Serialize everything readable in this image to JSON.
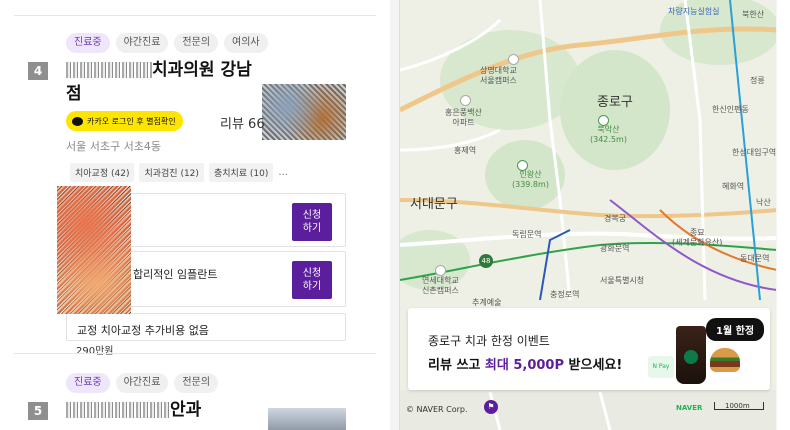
{
  "list": {
    "item4": {
      "rank": "4",
      "tags": [
        "진료중",
        "야간진료",
        "전문의",
        "여의사"
      ],
      "name_visible_1": "치과의원 강남",
      "name_visible_2": "점",
      "kakao_label": "카카오 로그인 후 별점확인",
      "review": "리뷰 66",
      "address": "서울 서초구 서초4동",
      "categories": [
        "치아교정 (42)",
        "치과검진 (12)",
        "충치치료 (10)"
      ],
      "categories_more": "...",
      "card2_text": "합리적인 임플란트",
      "card3_text": "교정 치아교정 추가비용 없음",
      "card3_price": "290만원",
      "apply_label_1": "신청",
      "apply_label_2": "하기"
    },
    "item5": {
      "rank": "5",
      "tags": [
        "진료중",
        "야간진료",
        "전문의"
      ],
      "name_visible": "안과"
    }
  },
  "map": {
    "labels": {
      "district_jongno": "종로구",
      "district_seodaemun": "서대문구",
      "sangmyung": "상명대학교\n서울캠퍼스",
      "hongeun": "홍은풍백산\n아파트",
      "bukaksan": "북악산\n(342.5m)",
      "inwangsan": "인왕산\n(339.8m)",
      "gyeongbokgung": "경복궁",
      "jongmyo": "종묘\n(세계문화유산)",
      "yonsei": "연세대학교\n신촌캠퍼스",
      "seoul_city_hall": "서울특별시청",
      "sungnyemun": "숭례문",
      "hansin": "한신인펜동",
      "hanseong": "한성대입구역",
      "charye": "차량지능실험실",
      "bukhan": "북한산",
      "jeongneung": "정릉",
      "hongje": "홍제역",
      "dongnimmun": "독립문역",
      "gwanghwamun": "광화문역",
      "jonggak": "종각역",
      "jongno3": "종로3가역",
      "euljiro": "을지로입구역",
      "seodaemun_stn": "서대문역",
      "chungjeongno": "충정로역",
      "ahyeon": "아현역",
      "chugye": "추계예술",
      "sinchon": "신촌역",
      "hyehwa": "혜화역",
      "naksan": "낙산",
      "dongdaemun": "동대문역",
      "sookdae": "숙대입구역",
      "seoul_stn": "서울역",
      "dongdaemun_gu": "동대문구",
      "road_48": "48"
    },
    "banner": {
      "title": "종로구 치과 한정 이벤트",
      "subtitle_pre": "리뷰 쓰고 ",
      "subtitle_hl": "최대 5,000P",
      "subtitle_post": " 받으세요!",
      "badge": "1월 한정",
      "pay": "N Pay"
    },
    "copyright": "© NAVER Corp.",
    "brand": "NAVER",
    "scale": "1000m"
  },
  "colors": {
    "accent": "#5b1e9c",
    "kakao": "#fee500",
    "naver_green": "#1eb44f"
  }
}
